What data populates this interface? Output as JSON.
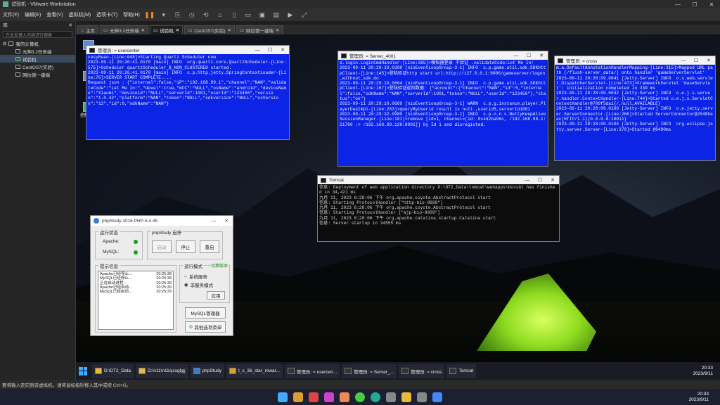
{
  "app": {
    "title": "试验机 - VMware Workstation"
  },
  "menu": [
    "文件(F)",
    "编辑(E)",
    "查看(V)",
    "虚拟机(M)",
    "选项卡(T)",
    "帮助(H)"
  ],
  "sidebar": {
    "header": "库",
    "search_placeholder": "在此处键入内容进行搜索",
    "root": "我的计算机",
    "items": [
      {
        "label": "元神3.2任务端"
      },
      {
        "label": "试验机",
        "selected": true
      },
      {
        "label": "CentOS7(实验)"
      },
      {
        "label": "网拉德一键端"
      }
    ]
  },
  "tabs": [
    {
      "label": "主页"
    },
    {
      "label": "元神3.2任务端"
    },
    {
      "label": "试验机",
      "active": true
    },
    {
      "label": "CentOS7(实验)"
    },
    {
      "label": "网拉德一键端"
    }
  ],
  "desktop_icons": [
    {
      "label": ""
    },
    {
      "label": ""
    },
    {
      "label": "控制面板"
    }
  ],
  "console_usercenter": {
    "title": "管理员: = usercenter",
    "text": "cesyBean-[Line:648]>Starting Quartz Scheduler now\n2023-09-11 20:26:41.0170 [main] INFO  org.quartz.core.QuartzScheduler-[Line:575]>Scheduler quartzScheduler_$_NON_CLUSTERED started.\n2023-09-11 20:26:41.0170 [main] INFO  c.p.http.jetty.SpringContextLoader-[Line:70]>SERVER START COMPLETE....\nRequest json : {\"internal\":false,\"iP\":\"192.168.99.1\",\"channel\":\"NAN\",\"validateCode\":\"Let Me In!\",\"devel\":true,\"mCC\":\"NULL\",\"osName\":\"android\",\"deviceName\":\"Xiaomi\",\"deviceid\":\"NULL\",\"serverId\":1001,\"userId\":\"123456\",\"version\":\"1.0.42\",\"platform\":\"NAN\",\"token\":\"NULL\",\"sdkversion\":\"NULL\",\"osVersion\":\"12\",\"id\":0,\"sdkName\":\"NAN\"}"
  },
  "console_server": {
    "title": "管理员: = Server_4001",
    "text": "d.login.LoginCmdHandler-[Line:385]>模拟器登录 不验证 .validateCode:Let Me In!\n2023-09-11 20:29:10.0398 [nioEventLoopGroup-3-1] INFO  c.p.game.util.sdk.SDKhttpClient-[Line:145]>登陆验证http start url:http://127.0.0.1:9006/gameserver/logon_without_sdk.do\n2023-09-11 20:29:10.0664 [nioEventLoopGroup-3-1] INFO  c.p.game.util.sdk.SDKhttpClient-[Line:167]>登陆验证返回数据: {\"account\":{\"channel\":\"NAN\",\"id\":5,\"internal\":false,\"sdkName\":\"NAN\",\"serverId\":1001,\"token\":\"NULL\",\"userId\":\"123456\"},\"status\":\"ok\"}\n2023-09-11 20:29:10.0669 [nioEventLoopGroup-3-1] WARN  c.p.g.instance.player.PlayerDaoImpl-[Line:253]>queryByUserid result is null ,userid5,serverId1001\n2023-09-11 20:29:32.0980 [nioEventLoopGroup-3-1] INFO  c.p.n.n.s.NettyKeepAliveSessionManager-[Line:101]>remove [id=1, channel=[id: 0x4d2ba96c, /192.168.99.1:51780 :> /192.168.99.128:8001]] by Id 1 and disregisted."
  },
  "console_cross": {
    "title": "管理员: = cross",
    "text": "m.a.DefaultAnnotationHandlerMapping-[Line:315]>Mapped URL path [/flush-server_data/] onto handler 'gameServerServlet'\n2023-09-11 20:28:09.0041 [Jetty-Server] INFO  o.s.web.servlet.DispatcherServlet-[Line:473]>FrameworkServlet 'baseServlet': initialization completed in 339 ms\n2023-09-11 20:28:09.0042 [Jetty-Server] INFO  o.e.j.s.server.handler.ContextHandler-[Line:744]>Started o.e.j.s.ServletContextHandler@709f5da1{/,null,AVAILABLE}\n2023-09-11 20:28:09.0100 [Jetty-Server] INFO  o.e.jetty.server.ServerConnector-[Line:266]>Started ServerConnector@2548beac{HTTP/1.1}{0.0.0.0:10011}\n2023-09-11 20:28:09.0104 [Jetty-Server] INFO  org.eclipse.jetty.server.Server-[Line:379]>Started @8490ms"
  },
  "console_tomcat": {
    "title": "Tomcat",
    "text": "信息: Deployment of web application directory D:\\DT2_Data\\tomcat\\webapps\\bossbt has finished in 34,421 ms\n九月 11, 2023 8:28:06 下午 org.apache.coyote.AbstractProtocol start\n信息: Starting ProtocolHandler [\"http-bio-8888\"]\n九月 11, 2023 8:28:06 下午 org.apache.coyote.AbstractProtocol start\n信息: Starting ProtocolHandler [\"ajp-bio-8009\"]\n九月 11, 2023 8:28:06 下午 org.apache.catalina.startup.Catalina start\n信息: Server startup in 34555 ms"
  },
  "phpstudy": {
    "title": "phpStudy 2016   PHP-5.4.45",
    "status_group": "运行状态",
    "apache": "Apache:",
    "mysql": "MySQL:",
    "start_group": "phpStudy 启停",
    "btn_start": "启动",
    "btn_stop": "停止",
    "btn_restart": "重启",
    "log_group": "提示信息",
    "logs": [
      {
        "msg": "Apache已经停止...",
        "time": "20:25:38"
      },
      {
        "msg": "MySQL已经停止...",
        "time": "20:25:38"
      },
      {
        "msg": "正在启动进程...",
        "time": "20:25:39"
      },
      {
        "msg": "Apache已经启动...",
        "time": "20:25:39"
      },
      {
        "msg": "MySQL已经启动...",
        "time": "20:25:39"
      }
    ],
    "mode_group": "运行模式",
    "switch_version": "切换版本",
    "mode_system": "系统服务",
    "mode_nonservice": "非服务模式",
    "btn_apply": "应用",
    "btn_mysql": "MySQL管理器",
    "btn_other": "其他选项菜单"
  },
  "taskbar": [
    {
      "label": "D:\\DT2_Data"
    },
    {
      "label": "D:\\n11\\n11sjcsgljgj"
    },
    {
      "label": "phpStudy"
    },
    {
      "label": "t_s_36_star_rewar..."
    },
    {
      "label": "管理员: = usercen..."
    },
    {
      "label": "管理员: = Server_..."
    },
    {
      "label": "管理员: = cross"
    },
    {
      "label": "Tomcat"
    }
  ],
  "guest_clock": {
    "time": "20:33",
    "date": "2023/9/11"
  },
  "statusbar": "要将输入定向到该虚拟机，请将鼠标指针移入其中或按 Ctrl+G。",
  "host_clock": {
    "time": "20:33",
    "date": "2023/9/11"
  },
  "colors": {
    "console_blue": "#0b24e6",
    "tent_green": "#a6e22e",
    "accent": "#3a6fd8"
  }
}
